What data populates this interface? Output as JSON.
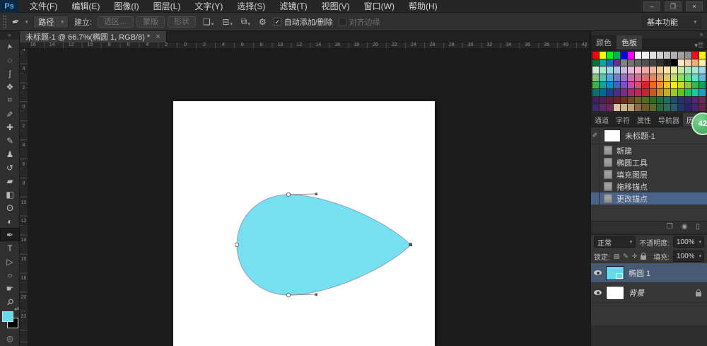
{
  "window": {
    "buttons": [
      "–",
      "❐",
      "×"
    ],
    "workspace": "基本功能"
  },
  "menu_bar": {
    "logo": "Ps",
    "items": [
      "文件(F)",
      "编辑(E)",
      "图像(I)",
      "图层(L)",
      "文字(Y)",
      "选择(S)",
      "滤镜(T)",
      "视图(V)",
      "窗口(W)",
      "帮助(H)"
    ]
  },
  "options_bar": {
    "preset_tool_icon": "✒",
    "arrow": "▾",
    "mode": "路径",
    "make_label": "建立:",
    "make_buttons": [
      "选区…",
      "蒙版",
      "形状"
    ],
    "icon_path_ops": "❏",
    "icon_align": "⊟",
    "icon_arrange": "⧉",
    "icon_gear": "⚙",
    "check_glyph": "✓",
    "auto_label": "自动添加/删除",
    "align_edges_label": "对齐边缘"
  },
  "document_tab": {
    "title": "未标题-1 @ 66.7%(椭圆 1, RGB/8) *",
    "close_glyph": "×"
  },
  "toolbar": {
    "collapse_glyph": "»",
    "tools": [
      {
        "name": "move-tool",
        "glyph": "➤"
      },
      {
        "name": "marquee-tool",
        "glyph": "◌"
      },
      {
        "name": "lasso-tool",
        "glyph": "ʃ"
      },
      {
        "name": "quick-selection-tool",
        "glyph": "❖"
      },
      {
        "name": "crop-tool",
        "glyph": "⌗"
      },
      {
        "name": "eyedropper-tool",
        "glyph": "✐"
      },
      {
        "name": "healing-brush-tool",
        "glyph": "✚"
      },
      {
        "name": "brush-tool",
        "glyph": "✎"
      },
      {
        "name": "clone-stamp-tool",
        "glyph": "♟"
      },
      {
        "name": "history-brush-tool",
        "glyph": "↺"
      },
      {
        "name": "eraser-tool",
        "glyph": "▰"
      },
      {
        "name": "gradient-tool",
        "glyph": "◧"
      },
      {
        "name": "blur-tool",
        "glyph": "ʘ"
      },
      {
        "name": "dodge-tool",
        "glyph": "◐"
      },
      {
        "name": "pen-tool",
        "glyph": "✒",
        "selected": true
      },
      {
        "name": "type-tool",
        "glyph": "T"
      },
      {
        "name": "path-selection-tool",
        "glyph": "▷"
      },
      {
        "name": "ellipse-shape-tool",
        "glyph": "○"
      },
      {
        "name": "hand-tool",
        "glyph": "☛"
      },
      {
        "name": "zoom-tool",
        "glyph": "⚲"
      }
    ],
    "swap_glyph": "⇄",
    "foreground": "#66d9ec",
    "background": "#000000",
    "quickmask_glyph": "◎"
  },
  "rulers": {
    "top_labels": [
      "16",
      "14",
      "12",
      "10",
      "8",
      "6",
      "4",
      "2",
      "0",
      "2",
      "4",
      "6",
      "8",
      "10",
      "12",
      "14",
      "16",
      "18",
      "20",
      "22",
      "24",
      "26",
      "28",
      "30",
      "32",
      "34",
      "36",
      "38",
      "40",
      "42"
    ],
    "left_labels": [
      "6",
      "4",
      "2",
      "0",
      "2",
      "4",
      "6",
      "8",
      "10",
      "12",
      "14",
      "16",
      "18",
      "20",
      "22"
    ]
  },
  "canvas": {
    "shape_fill": "#76dff2",
    "shape_outline": "#93a2b5"
  },
  "dock": {
    "collapse_glyph": "»",
    "swatches": {
      "tabs": [
        "颜色",
        "色板"
      ],
      "active": "色板",
      "menu_glyph": "▾☰",
      "colors": [
        "#FF0000",
        "#FFFF00",
        "#00FF00",
        "#00B14F",
        "#0000FF",
        "#FF00FF",
        "#FFFFFF",
        "#F0F0F0",
        "#E0E0E0",
        "#D1D1D1",
        "#C1C1C1",
        "#B1B1B1",
        "#A1A1A1",
        "#919191",
        "#FF0C0C",
        "#FFF60C",
        "#007236",
        "#00A99D",
        "#0072BC",
        "#662D91",
        "#828282",
        "#727272",
        "#626262",
        "#515151",
        "#414141",
        "#313131",
        "#1B1B1B",
        "#000000",
        "#FFE6C4",
        "#F9D1A4",
        "#F5B06E",
        "#FFF2AE",
        "#C4F2DD",
        "#A7E6CE",
        "#9ED8E6",
        "#A9C6E8",
        "#C7B7E2",
        "#E6B8D7",
        "#F5B3C8",
        "#F2A7A7",
        "#EFB99F",
        "#EDCB9B",
        "#F2E3A6",
        "#E8F2A6",
        "#C6E8A6",
        "#A6E8B8",
        "#A6E8DC",
        "#A6D4E8",
        "#7CC576",
        "#56C5B8",
        "#4FA8D8",
        "#6A82C5",
        "#9B6FC5",
        "#C56FAE",
        "#D86F93",
        "#E06C6C",
        "#E08A5E",
        "#E0A95E",
        "#E0CC5E",
        "#C2E05E",
        "#8AE05E",
        "#5EE08A",
        "#5EE0C9",
        "#5EB8E0",
        "#39B54A",
        "#00A99D",
        "#0092D0",
        "#3F64B0",
        "#7F4FC5",
        "#C04FA8",
        "#D84F74",
        "#ED1C24",
        "#F26522",
        "#F7941D",
        "#FFC20E",
        "#FFF200",
        "#C5DB26",
        "#8DC63F",
        "#39B54A",
        "#00A651",
        "#00746B",
        "#006B8F",
        "#1B3F94",
        "#4B2E83",
        "#7D2B8B",
        "#A82B6E",
        "#C5215A",
        "#C1272D",
        "#C75B1F",
        "#C78A1F",
        "#C7B01F",
        "#9BC71F",
        "#5BC71F",
        "#1FC75B",
        "#1FC7A0",
        "#1F9BC7",
        "#3F1F5E",
        "#4F1F4F",
        "#5E1F3F",
        "#6E1F2B",
        "#6E2F1F",
        "#6E4A1F",
        "#6E611F",
        "#4F6E1F",
        "#2B6E1F",
        "#1F6E3F",
        "#1F6E61",
        "#1F4F6E",
        "#26316E",
        "#3A266E",
        "#55266E",
        "#6E2655",
        "#3A2A6B",
        "#5C2A6B",
        "#6B2A5C",
        "#D9C6A0",
        "#CCB68C",
        "#BFA377",
        "#8C6B4A",
        "#6B5C2A",
        "#5C6B2A",
        "#2A6B3A",
        "#2A6B5C",
        "#2A5C6B",
        "#21346B",
        "#2A216B",
        "#4A216B",
        "#6B214A"
      ]
    },
    "tabs": [
      "通道",
      "字符",
      "属性",
      "导航器",
      "历史记录"
    ],
    "active_tab": "历史记录",
    "history": {
      "brush_glyph": "✐",
      "snapshot": "未标题-1",
      "items": [
        {
          "label": "新建"
        },
        {
          "label": "椭圆工具"
        },
        {
          "label": "填充图层"
        },
        {
          "label": "拖移锚点"
        },
        {
          "label": "更改锚点",
          "selected": true
        }
      ],
      "footer_icons": [
        "❐",
        "◉",
        "▯"
      ]
    },
    "layers": {
      "blend": "正常",
      "arrow": "▾",
      "opacity_label": "不透明度:",
      "opacity": "100%",
      "lock_label": "锁定:",
      "lock_icons": [
        "▨",
        "✎",
        "✛"
      ],
      "fill_label": "填充:",
      "fill": "100%",
      "rows": [
        {
          "label": "椭圆 1",
          "selected": true,
          "thumb": "#66d9ec",
          "mask": true
        },
        {
          "label": "背景",
          "italic": true,
          "thumb": "#ffffff",
          "locked": true
        }
      ]
    }
  },
  "badge": {
    "value": "42"
  }
}
